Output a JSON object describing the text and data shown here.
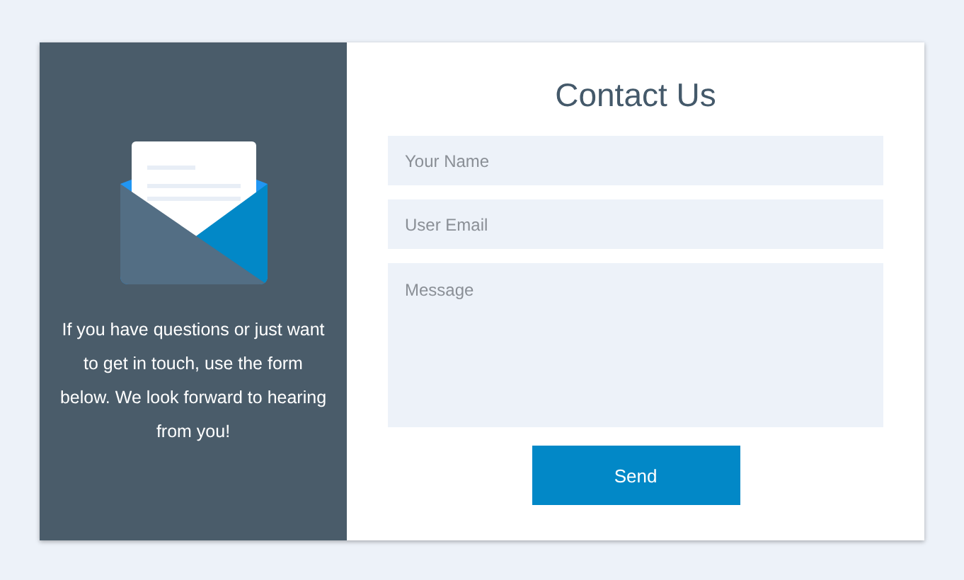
{
  "intro": {
    "text": "If you have questions or just want to get in touch, use the form below. We look forward to hearing from you!"
  },
  "form": {
    "title": "Contact Us",
    "fields": [
      {
        "kind": "line",
        "placeholder": "Your Name"
      },
      {
        "kind": "line",
        "placeholder": "User Email"
      },
      {
        "kind": "area",
        "placeholder": "Message"
      }
    ],
    "submit": "Send"
  }
}
